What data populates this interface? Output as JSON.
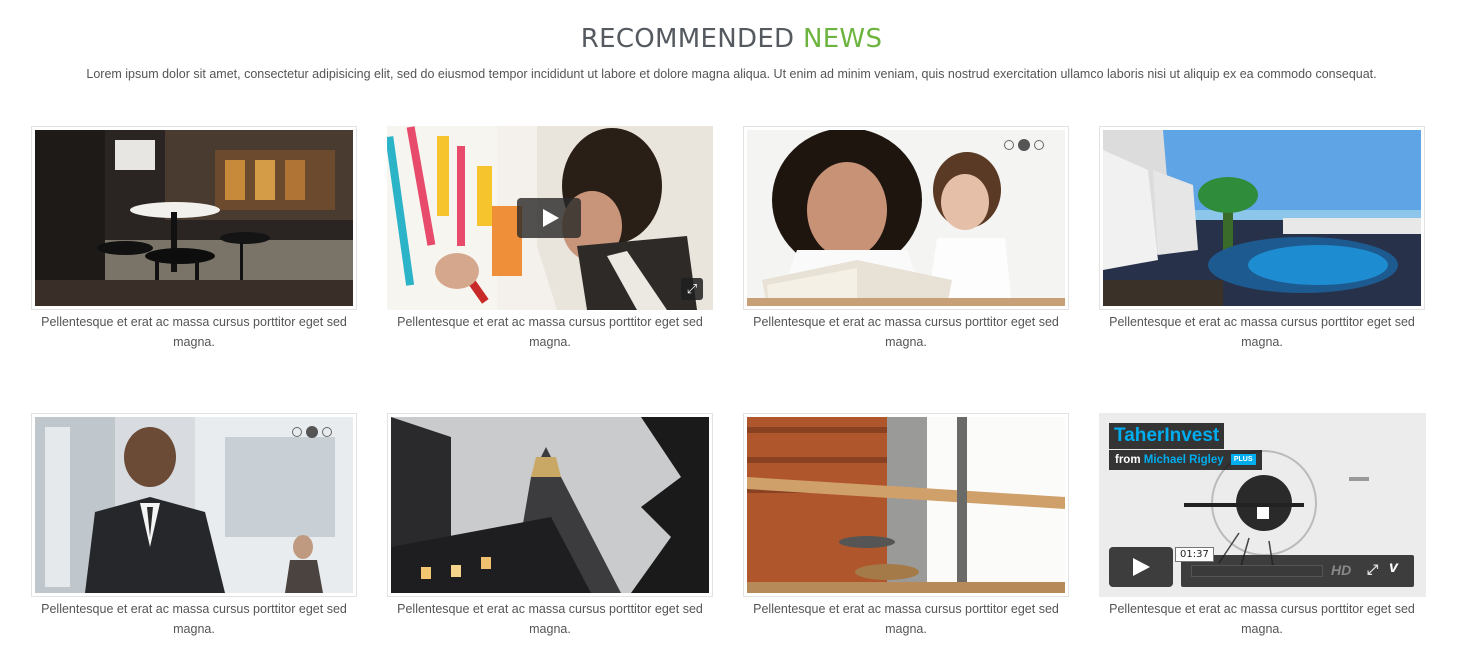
{
  "header": {
    "title_main": "RECOMMENDED",
    "title_accent": "NEWS",
    "intro": "Lorem ipsum dolor sit amet, consectetur adipisicing elit, sed do eiusmod tempor incididunt ut labore et dolore magna aliqua. Ut enim ad minim veniam, quis nostrud exercitation ullamco laboris nisi ut aliquip ex ea commodo consequat."
  },
  "colors": {
    "accent": "#6cb43f",
    "heading": "#555a60",
    "text": "#555555",
    "vimeo_blue": "#00adef"
  },
  "cards": [
    {
      "image": "cafe-interior-photo",
      "caption": "Pellentesque et erat ac massa cursus porttitor eget sed magna."
    },
    {
      "image": "man-painting-video",
      "caption": "Pellentesque et erat ac massa cursus porttitor eget sed magna."
    },
    {
      "image": "women-reading-slideshow",
      "caption": "Pellentesque et erat ac massa cursus porttitor eget sed magna."
    },
    {
      "image": "resort-pool-photo",
      "caption": "Pellentesque et erat ac massa cursus porttitor eget sed magna."
    },
    {
      "image": "businessman-slideshow",
      "caption": "Pellentesque et erat ac massa cursus porttitor eget sed magna."
    },
    {
      "image": "skyscraper-photo",
      "caption": "Pellentesque et erat ac massa cursus porttitor eget sed magna."
    },
    {
      "image": "cafe-window-photo",
      "caption": "Pellentesque et erat ac massa cursus porttitor eget sed magna."
    },
    {
      "image": "vimeo-video-embed",
      "caption": "Pellentesque et erat ac massa cursus porttitor eget sed magna."
    }
  ],
  "vimeo": {
    "title": "TaherInvest",
    "from": "from",
    "author": "Michael Rigley",
    "plus": "PLUS",
    "time": "01:37",
    "hd": "HD",
    "fullscreen_icon": "⤢",
    "logo": "v"
  },
  "icons": {
    "play": "play-icon",
    "expand": "expand-icon",
    "expand_glyph": "⤢"
  }
}
